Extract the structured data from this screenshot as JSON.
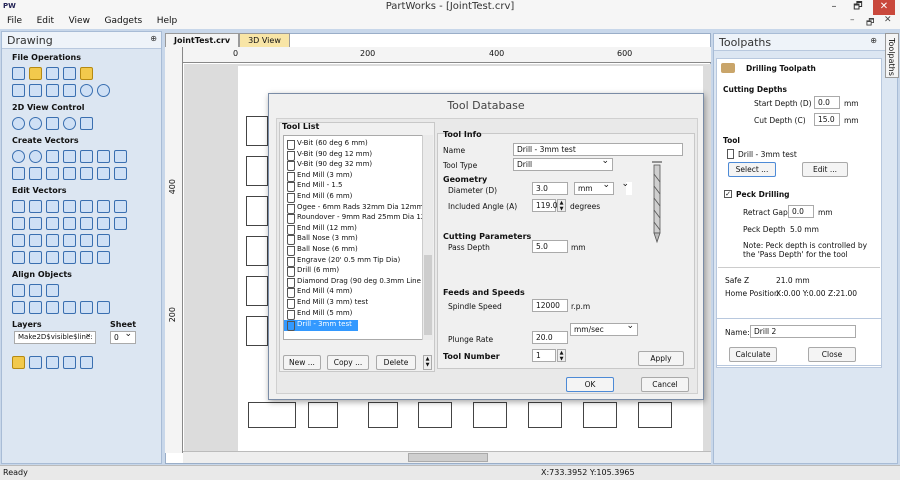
{
  "app": {
    "icon": "PW",
    "title": "PartWorks - [JointTest.crv]"
  },
  "window_buttons": [
    "–",
    "🗗",
    "✕"
  ],
  "mdi_buttons": [
    "–",
    "🗗",
    "✕"
  ],
  "menu": [
    "File",
    "Edit",
    "View",
    "Gadgets",
    "Help"
  ],
  "drawing": {
    "header": "Drawing",
    "pin": "⊕",
    "sections": {
      "file": "File Operations",
      "view": "2D View Control",
      "create": "Create Vectors",
      "edit": "Edit Vectors",
      "align": "Align Objects"
    },
    "layers_label": "Layers",
    "sheet_label": "Sheet",
    "layer_value": "Make2D$visible$line:",
    "sheet_value": "0"
  },
  "tabs": [
    "JointTest.crv",
    "3D View"
  ],
  "ruler": {
    "top": [
      "0",
      "200",
      "400",
      "600"
    ],
    "left": [
      "400",
      "200"
    ]
  },
  "dialog": {
    "title": "Tool Database",
    "tool_list_label": "Tool List",
    "tools": [
      "V-Bit (60 deg 6 mm)",
      "V-Bit (90 deg 12 mm)",
      "V-Bit (90 deg 32 mm)",
      "End Mill (3 mm)",
      "End Mill - 1.5",
      "End Mill (6 mm)",
      "Ogee - 6mm Rads 32mm Dia 12mm Deep",
      "Roundover - 9mm Rad 25mm Dia 12mm",
      "End Mill (12 mm)",
      "Ball Nose (3 mm)",
      "Ball Nose (6 mm)",
      "Engrave (20' 0.5 mm Tip Dia)",
      "Drill (6 mm)",
      "Diamond Drag (90 deg 0.3mm Line Width",
      "End Mill (4 mm)",
      "End Mill (3 mm) test",
      "End Mill (5 mm)",
      "Drill - 3mm test"
    ],
    "selected_tool": "Drill - 3mm test",
    "new_btn": "New ...",
    "copy_btn": "Copy ...",
    "delete_btn": "Delete",
    "tool_info": "Tool Info",
    "name_label": "Name",
    "name_value": "Drill - 3mm test",
    "tooltype_label": "Tool Type",
    "tooltype_value": "Drill",
    "geometry": "Geometry",
    "diameter_label": "Diameter (D)",
    "diameter_value": "3.0",
    "diameter_unit": "mm",
    "angle_label": "Included Angle (A)",
    "angle_value": "119.0",
    "angle_unit": "degrees",
    "cutting_params": "Cutting Parameters",
    "pass_depth_label": "Pass Depth",
    "pass_depth_value": "5.0",
    "pass_depth_unit": "mm",
    "feeds_speeds": "Feeds and Speeds",
    "spindle_label": "Spindle Speed",
    "spindle_value": "12000",
    "spindle_unit": "r.p.m",
    "rate_unit": "mm/sec",
    "plunge_label": "Plunge Rate",
    "plunge_value": "20.0",
    "tool_number_label": "Tool Number",
    "tool_number_value": "1",
    "apply_btn": "Apply",
    "ok_btn": "OK",
    "cancel_btn": "Cancel"
  },
  "toolpaths": {
    "header": "Toolpaths",
    "sidetab": "Toolpaths",
    "pin": "⊕",
    "close": "✕",
    "title": "Drilling Toolpath",
    "cutting_depths": "Cutting Depths",
    "start_depth_label": "Start Depth (D)",
    "start_depth_value": "0.0",
    "cut_depth_label": "Cut Depth (C)",
    "cut_depth_value": "15.0",
    "unit": "mm",
    "tool_label": "Tool",
    "tool_value": "Drill - 3mm test",
    "select_btn": "Select ...",
    "edit_btn": "Edit ...",
    "peck_label": "Peck Drilling",
    "retract_label": "Retract Gap",
    "retract_value": "0.0",
    "peck_depth_label": "Peck Depth",
    "peck_depth_value": "5.0 mm",
    "note": "Note: Peck depth is controlled by the 'Pass Depth' for the tool",
    "safe_z_label": "Safe Z",
    "safe_z_value": "21.0 mm",
    "home_label": "Home Position",
    "home_value": "X:0.00 Y:0.00 Z:21.00",
    "name_label": "Name:",
    "name_value": "Drill 2",
    "calculate_btn": "Calculate",
    "close_btn": "Close"
  },
  "status": {
    "left": "Ready",
    "coords": "X:733.3952 Y:105.3965"
  }
}
